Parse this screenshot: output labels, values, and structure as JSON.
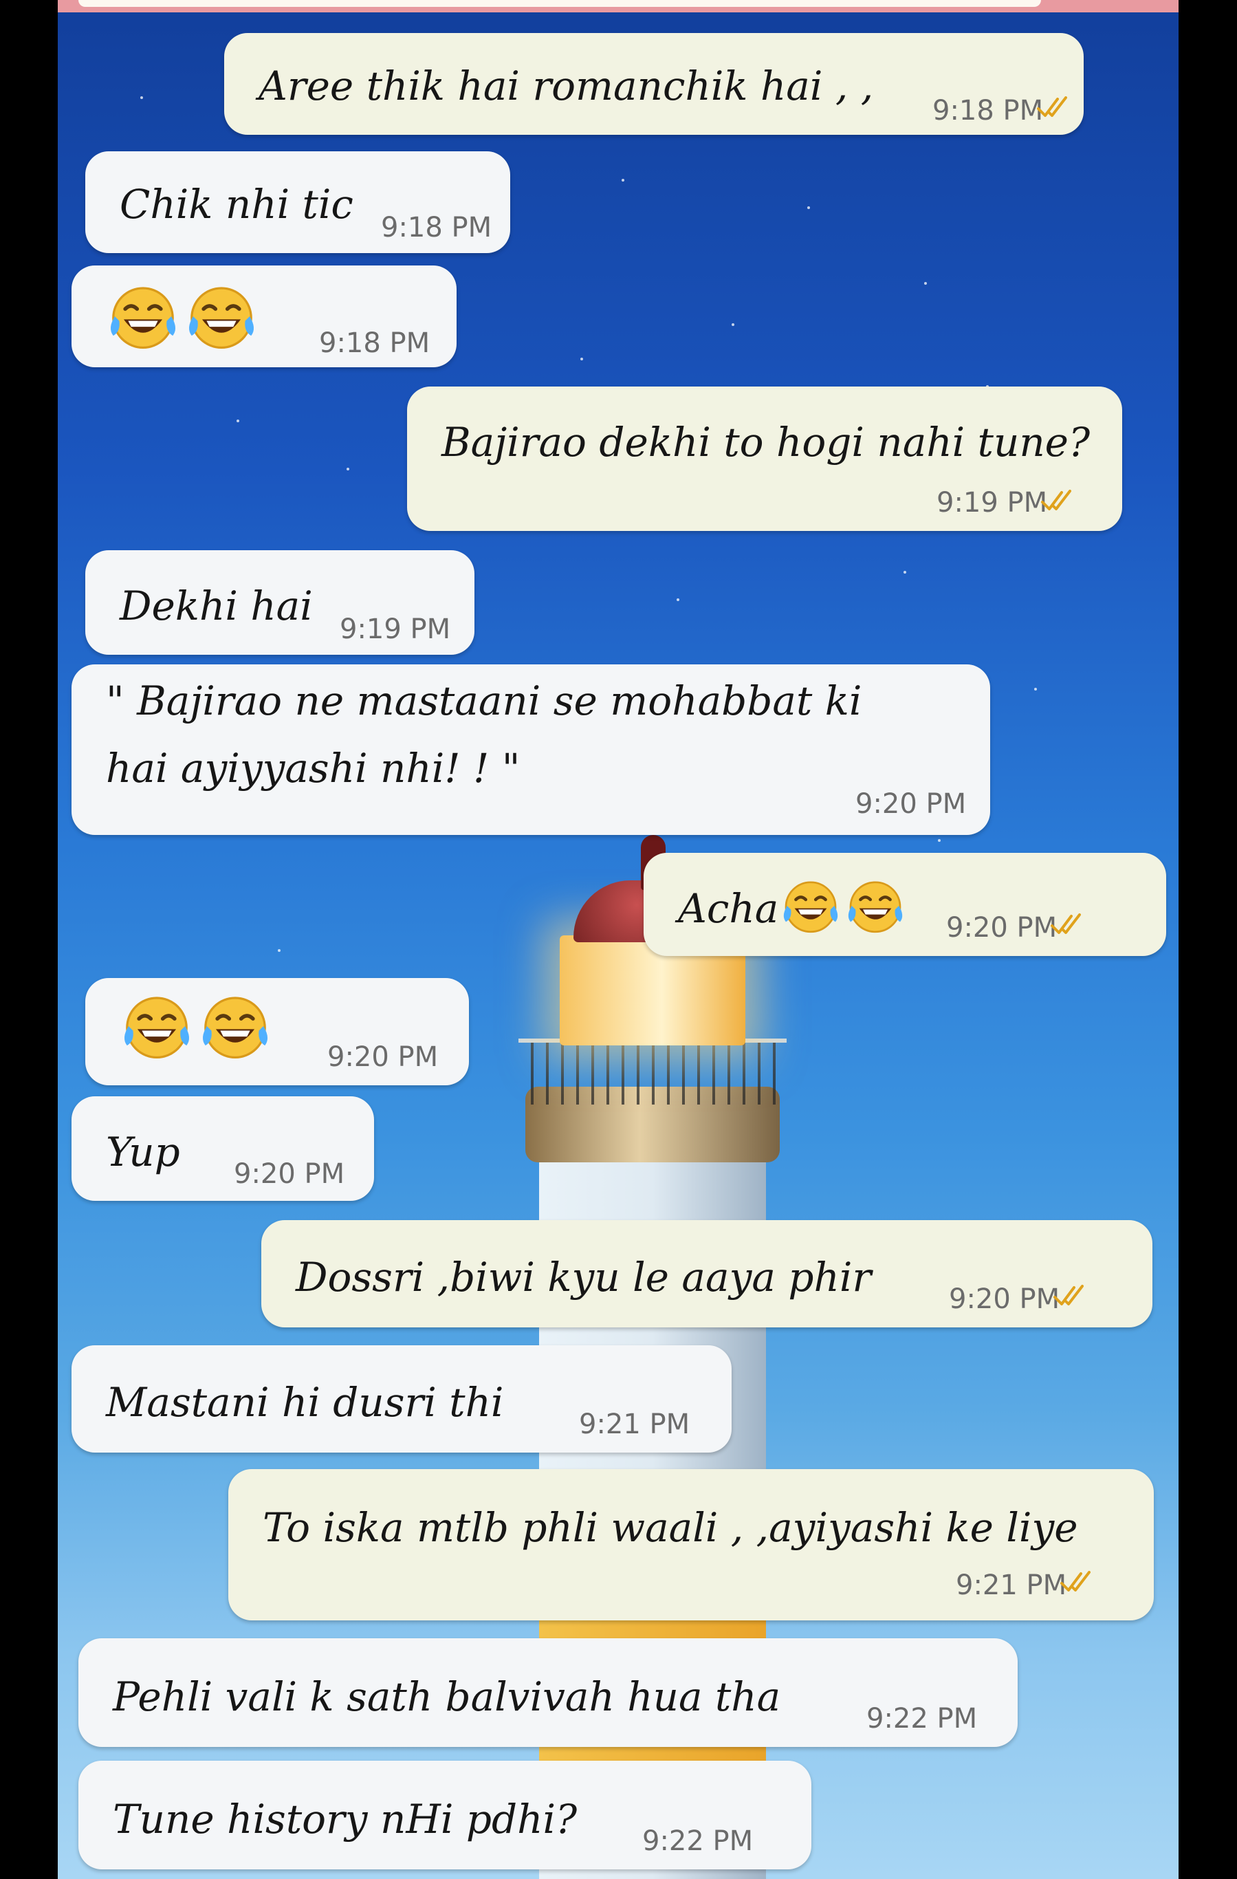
{
  "chat": {
    "messages": [
      {
        "dir": "out",
        "text": "Aree thik hai romanchik hai , ,",
        "time": "9:18 PM",
        "ticks": "read"
      },
      {
        "dir": "in",
        "text": "Chik nhi tic",
        "time": "9:18 PM"
      },
      {
        "dir": "in",
        "emoji": [
          "face-with-tears-of-joy",
          "face-with-tears-of-joy"
        ],
        "time": "9:18 PM"
      },
      {
        "dir": "out",
        "text": "Bajirao dekhi to hogi nahi tune?",
        "time": "9:19 PM",
        "ticks": "read"
      },
      {
        "dir": "in",
        "text": "Dekhi hai",
        "time": "9:19 PM"
      },
      {
        "dir": "in",
        "text": "\" Bajirao ne mastaani se mohabbat ki hai ayiyyashi nhi! ! \"",
        "time": "9:20 PM"
      },
      {
        "dir": "out",
        "text": "Acha",
        "emoji": [
          "face-with-tears-of-joy",
          "face-with-tears-of-joy"
        ],
        "time": "9:20 PM",
        "ticks": "read"
      },
      {
        "dir": "in",
        "emoji": [
          "face-with-tears-of-joy",
          "face-with-tears-of-joy"
        ],
        "time": "9:20 PM"
      },
      {
        "dir": "in",
        "text": "Yup",
        "time": "9:20 PM"
      },
      {
        "dir": "out",
        "text": "Dossri ,biwi kyu le aaya phir",
        "time": "9:20 PM",
        "ticks": "read"
      },
      {
        "dir": "in",
        "text": "Mastani hi dusri thi",
        "time": "9:21 PM"
      },
      {
        "dir": "out",
        "text": "To iska mtlb phli waali , ,ayiyashi ke liye",
        "time": "9:21 PM",
        "ticks": "read"
      },
      {
        "dir": "in",
        "text": "Pehli vali k sath balvivah hua tha",
        "time": "9:22 PM"
      },
      {
        "dir": "in",
        "text": "Tune history nHi pdhi?",
        "time": "9:22 PM"
      }
    ]
  },
  "colors": {
    "incoming_bubble": "#f4f6f8",
    "outgoing_bubble": "#f2f3e2",
    "tick_read": "#e0a21c",
    "wallpaper_top": "#123f9c",
    "wallpaper_bottom": "#a8d6f4"
  },
  "icons": {
    "tick": "double-check-icon",
    "emoji": "face-with-tears-of-joy-icon"
  }
}
